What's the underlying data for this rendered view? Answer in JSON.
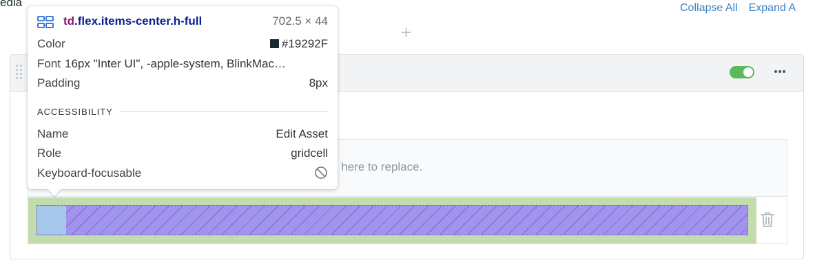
{
  "page": {
    "section_label_partial": "edia",
    "collapse_all": "Collapse All",
    "expand_all": "Expand A",
    "add_icon": "plus-icon"
  },
  "block": {
    "drag_icon": "drag-handle-icon",
    "toggle_on": true,
    "menu_icon": "more-horizontal-icon",
    "dropzone_hint": "p here to replace.",
    "delete_icon": "trash-icon"
  },
  "inspector": {
    "element_icon": "layout-icon",
    "tag": "td",
    "classes": ".flex.items-center.h-full",
    "dimensions": "702.5 × 44",
    "color_label": "Color",
    "color_value": "#19292F",
    "font_label": "Font",
    "font_value": "16px \"Inter UI\", -apple-system, BlinkMac…",
    "padding_label": "Padding",
    "padding_value": "8px",
    "accessibility_heading": "ACCESSIBILITY",
    "name_label": "Name",
    "name_value": "Edit Asset",
    "role_label": "Role",
    "role_value": "gridcell",
    "focusable_label": "Keyboard-focusable",
    "focusable_icon": "not-allowed-icon"
  },
  "colors": {
    "link": "#3b82c4",
    "toggle_on": "#5cb85c",
    "highlight_margin": "#c2dcae",
    "highlight_content": "#9f95ec",
    "highlight_padding": "#a5c8ea"
  }
}
